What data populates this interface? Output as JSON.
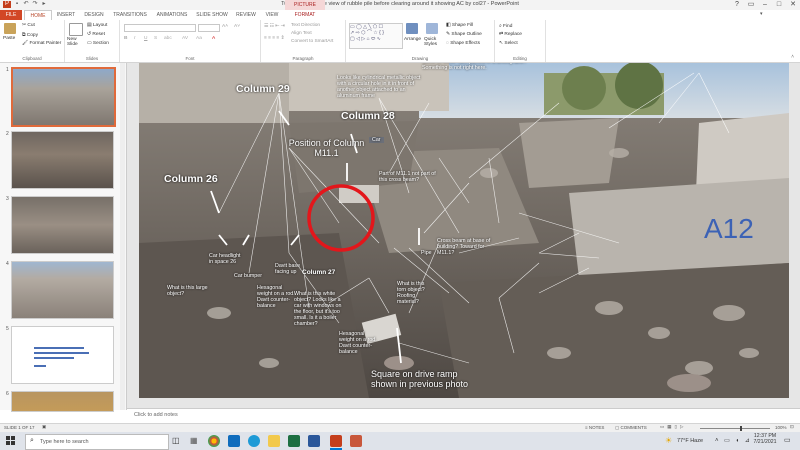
{
  "window": {
    "title": "Tu Tac perspective view of rubble pile before clearing around it showing AC by col27 - PowerPoint",
    "context_tab": "PICTURE TOOLS",
    "controls": [
      "?",
      "▭",
      "–",
      "□",
      "✕"
    ]
  },
  "tabs": [
    "FILE",
    "HOME",
    "INSERT",
    "DESIGN",
    "TRANSITIONS",
    "ANIMATIONS",
    "SLIDE SHOW",
    "REVIEW",
    "VIEW",
    "FORMAT"
  ],
  "active_tab": "HOME",
  "ribbon": {
    "clipboard": {
      "paste": "Paste",
      "cut": "Cut",
      "copy": "Copy",
      "format_painter": "Format Painter",
      "label": "Clipboard"
    },
    "slides": {
      "new_slide": "New Slide",
      "layout": "Layout",
      "reset": "Reset",
      "section": "Section",
      "label": "Slides"
    },
    "font": {
      "label": "Font",
      "font_name": "",
      "font_size": ""
    },
    "paragraph": {
      "label": "Paragraph",
      "text_direction": "Text Direction",
      "align_text": "Align Text",
      "convert_smartart": "Convert to SmartArt"
    },
    "drawing": {
      "label": "Drawing",
      "arrange": "Arrange",
      "quick_styles": "Quick Styles",
      "shape_fill": "Shape Fill",
      "shape_outline": "Shape Outline",
      "shape_effects": "Shape Effects"
    },
    "editing": {
      "label": "Editing",
      "find": "Find",
      "replace": "Replace",
      "select": "Select"
    }
  },
  "slides_panel": {
    "numbers": [
      "1",
      "2",
      "3",
      "4",
      "5",
      "6"
    ],
    "selected": 1
  },
  "slide": {
    "labels": {
      "column29": "Column 29",
      "column28": "Column 28",
      "position_m111": "Position of Column M11.1",
      "column26": "Column 26",
      "column27": "Column 27",
      "car_tag": "Car",
      "cylinder_note": "Looks like cylindrical metallic object with a circular hole in it in front of another object attached to an aluminum frame",
      "parked_cars_note": "Some of these cars parked in a driving lane? Something is not right here.",
      "m111_part_note": "Part of M11.1 not part of this cross beam?",
      "pipe": "Pipe",
      "cross_beam_note": "Cross beam at base of building? Toward for M11.1?",
      "large_object_note": "What is this large object?",
      "car_headlight": "Car headlight in space 26",
      "car_bumper": "Car bumper",
      "davit_base": "Davit base facing up",
      "hex_weight1": "Hexagonal weight on a rod. Davit counter-balance",
      "white_object": "What is this white object? Looks like a car with windows on the floor, but it's too small. Is it a boiler chamber?",
      "torn_object": "What is this torn object? Roofing material?",
      "hex_weight2": "Hexagonal weight on a rod. Davit counter-balance",
      "square_note": "Square on drive ramp shown in previous photo",
      "graffiti": "A12"
    }
  },
  "notes": {
    "placeholder": "Click to add notes"
  },
  "status": {
    "slide": "SLIDE 1 OF 17",
    "notes": "NOTES",
    "comments": "COMMENTS",
    "zoom": "100%"
  },
  "taskbar": {
    "search_placeholder": "Type here to search",
    "weather": "77°F  Haze",
    "time": "12:37 PM",
    "date": "7/21/2021"
  },
  "colors": {
    "accent": "#d24726",
    "selection": "#e06a3b",
    "format_tab": "#a22222"
  }
}
